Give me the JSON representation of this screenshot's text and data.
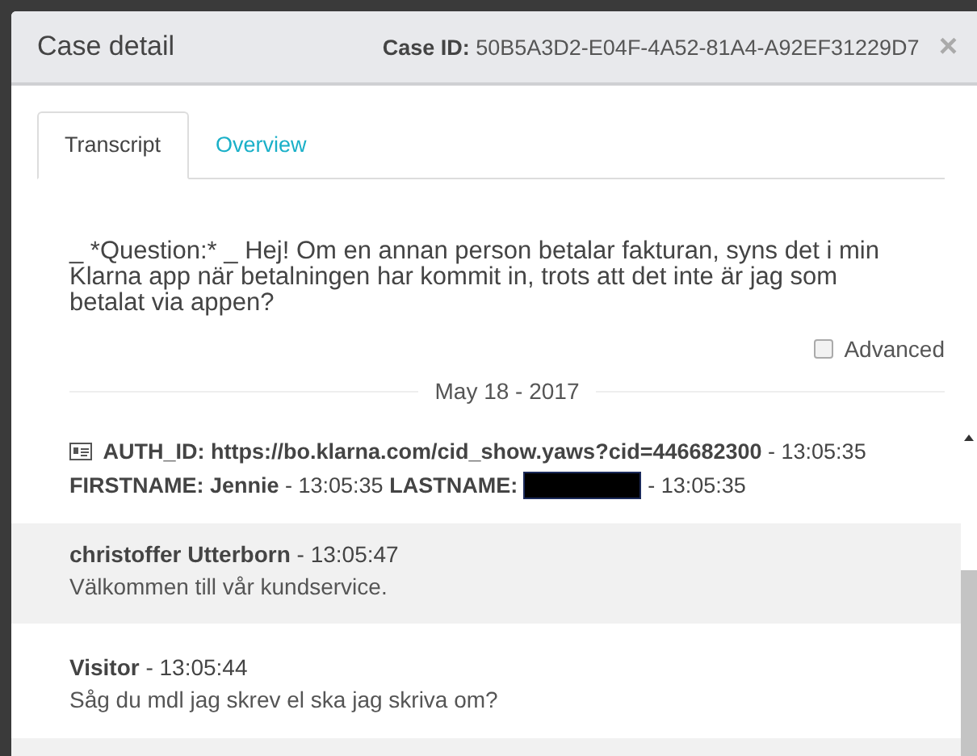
{
  "window": {
    "title": "Case detail",
    "case_id_label": "Case ID:",
    "case_id": "50B5A3D2-E04F-4A52-81A4-A92EF31229D7",
    "close": "×"
  },
  "tabs": [
    {
      "label": "Transcript",
      "selected": true
    },
    {
      "label": "Overview",
      "selected": false
    }
  ],
  "question": "_ *Question:* _ Hej! Om en annan person betalar fakturan, syns det i min Klarna app när betalningen har kommit in, trots att det inte är jag som betalat via appen?",
  "advanced": {
    "label": "Advanced",
    "checked": false
  },
  "date": "May 18 - 2017",
  "messages": [
    {
      "kind": "system",
      "segments": [
        {
          "kind": "text",
          "text": "**AUTH_ID: https://bo.klarna.com/cid_show.yaws?cid=446682300** - 13:05:35 **FIRSTNAME: Jennie** - 13:05:35 **LASTNAME:**"
        },
        {
          "kind": "redacted"
        },
        {
          "kind": "text",
          "text": "- 13:05:35"
        }
      ]
    },
    {
      "kind": "agent",
      "author": "christoffer Utterborn",
      "time": "- 13:05:47",
      "text": "Välkommen till vår kundservice."
    },
    {
      "kind": "visitor",
      "author": "Visitor",
      "time": "- 13:05:44",
      "text": "Såg du mdl jag skrev el ska jag skriva om?"
    }
  ]
}
